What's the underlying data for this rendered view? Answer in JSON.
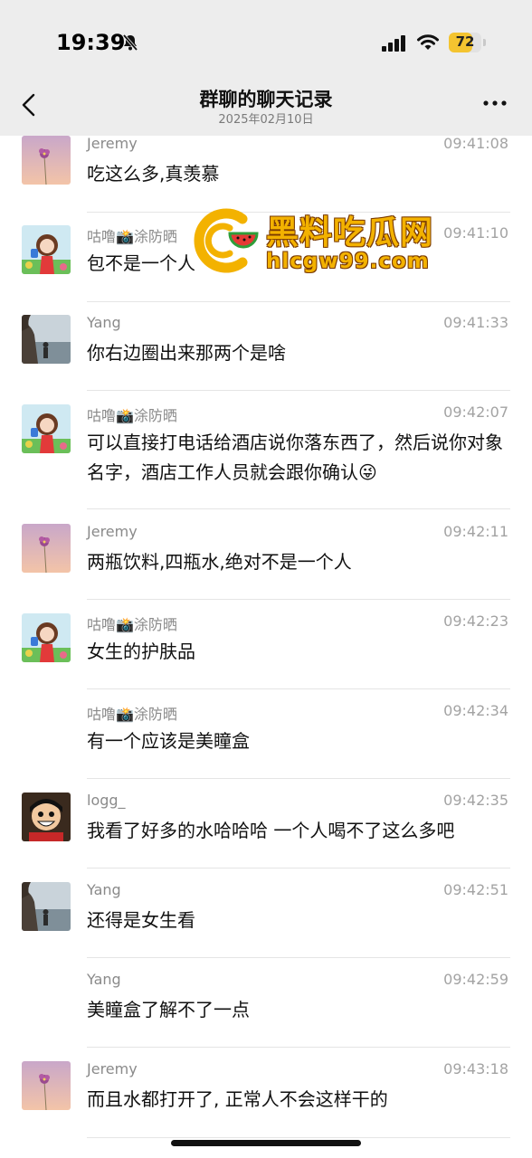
{
  "status_bar": {
    "time": "19:39",
    "battery": "72",
    "battery_level": 0.72
  },
  "header": {
    "title": "群聊的聊天记录",
    "subtitle": "2025年02月10日"
  },
  "messages": [
    {
      "sender": "Jeremy",
      "time": "09:41:08",
      "text": "吃这么多,真羡慕",
      "avatar": "flower-avatar"
    },
    {
      "sender": "咕噜📸涂防晒",
      "time": "09:41:10",
      "text": "包不是一个人",
      "avatar": "cartoon-girl-avatar"
    },
    {
      "sender": "Yang",
      "time": "09:41:33",
      "text": "你右边圈出来那两个是啥",
      "avatar": "seaside-avatar"
    },
    {
      "sender": "咕噜📸涂防晒",
      "time": "09:42:07",
      "text": "可以直接打电话给酒店说你落东西了，然后说你对象名字，酒店工作人员就会跟你确认😜",
      "avatar": "cartoon-girl-avatar"
    },
    {
      "sender": "Jeremy",
      "time": "09:42:11",
      "text": "两瓶饮料,四瓶水,绝对不是一个人",
      "avatar": "flower-avatar"
    },
    {
      "sender": "咕噜📸涂防晒",
      "time": "09:42:23",
      "text": "女生的护肤品",
      "avatar": "cartoon-girl-avatar"
    },
    {
      "sender": "咕噜📸涂防晒",
      "time": "09:42:34",
      "text": "有一个应该是美瞳盒",
      "avatar": ""
    },
    {
      "sender": "logg_",
      "time": "09:42:35",
      "text": "我看了好多的水哈哈哈 一个人喝不了这么多吧",
      "avatar": "anime-pirate-avatar"
    },
    {
      "sender": "Yang",
      "time": "09:42:51",
      "text": "还得是女生看",
      "avatar": "seaside-avatar"
    },
    {
      "sender": "Yang",
      "time": "09:42:59",
      "text": "美瞳盒了解不了一点",
      "avatar": ""
    },
    {
      "sender": "Jeremy",
      "time": "09:43:18",
      "text": "而且水都打开了, 正常人不会这样干的",
      "avatar": "flower-avatar"
    }
  ],
  "watermark": {
    "title": "黑料吃瓜网",
    "url": "hlcgw99.com"
  },
  "icons": {
    "back": "chevron-left-icon",
    "more": "more-dots-icon",
    "bell": "bell-slash-icon",
    "signal": "cellular-signal-icon",
    "wifi": "wifi-icon"
  },
  "colors": {
    "bar_background": "#ededed",
    "battery_fill": "#f4c430",
    "watermark": "#f3b200"
  }
}
